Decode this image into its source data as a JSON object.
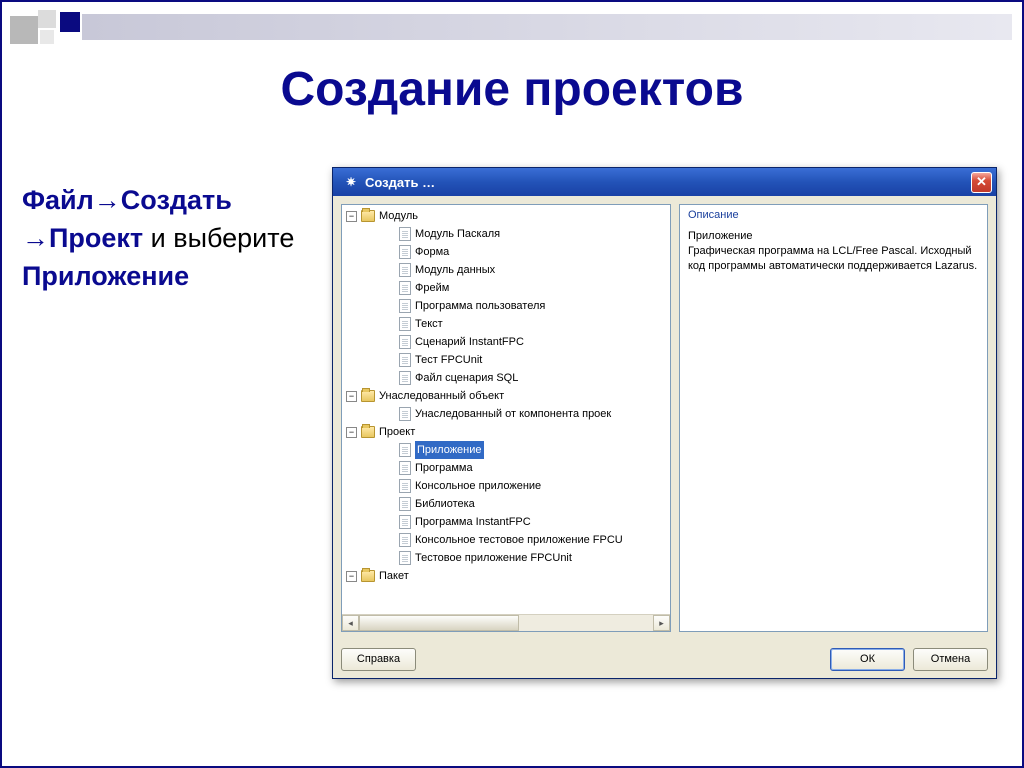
{
  "slide": {
    "title": "Создание проектов",
    "instruction": {
      "path1": "Файл→Создать",
      "path2": "→Проект",
      "middle": " и выберите ",
      "target": "Приложение"
    }
  },
  "dialog": {
    "title": "Создать …",
    "close_symbol": "✕",
    "help_button": "Справка",
    "ok_button": "ОК",
    "cancel_button": "Отмена",
    "tree": {
      "folders": [
        {
          "label": "Модуль",
          "expanded": true,
          "items": [
            "Модуль Паскаля",
            "Форма",
            "Модуль данных",
            "Фрейм",
            "Программа пользователя",
            "Текст",
            "Сценарий InstantFPC",
            "Тест FPCUnit",
            "Файл сценария SQL"
          ]
        },
        {
          "label": "Унаследованный объект",
          "expanded": true,
          "items": [
            "Унаследованный от компонента проек"
          ]
        },
        {
          "label": "Проект",
          "expanded": true,
          "items": [
            "Приложение",
            "Программа",
            "Консольное приложение",
            "Библиотека",
            "Программа InstantFPC",
            "Консольное тестовое приложение FPCU",
            "Тестовое приложение FPCUnit"
          ],
          "selected_index": 0
        },
        {
          "label": "Пакет",
          "expanded": true,
          "items": []
        }
      ]
    },
    "description": {
      "heading": "Описание",
      "title": "Приложение",
      "body": "Графическая программа на LCL/Free Pascal. Исходный код программы автоматически поддерживается Lazarus."
    }
  }
}
